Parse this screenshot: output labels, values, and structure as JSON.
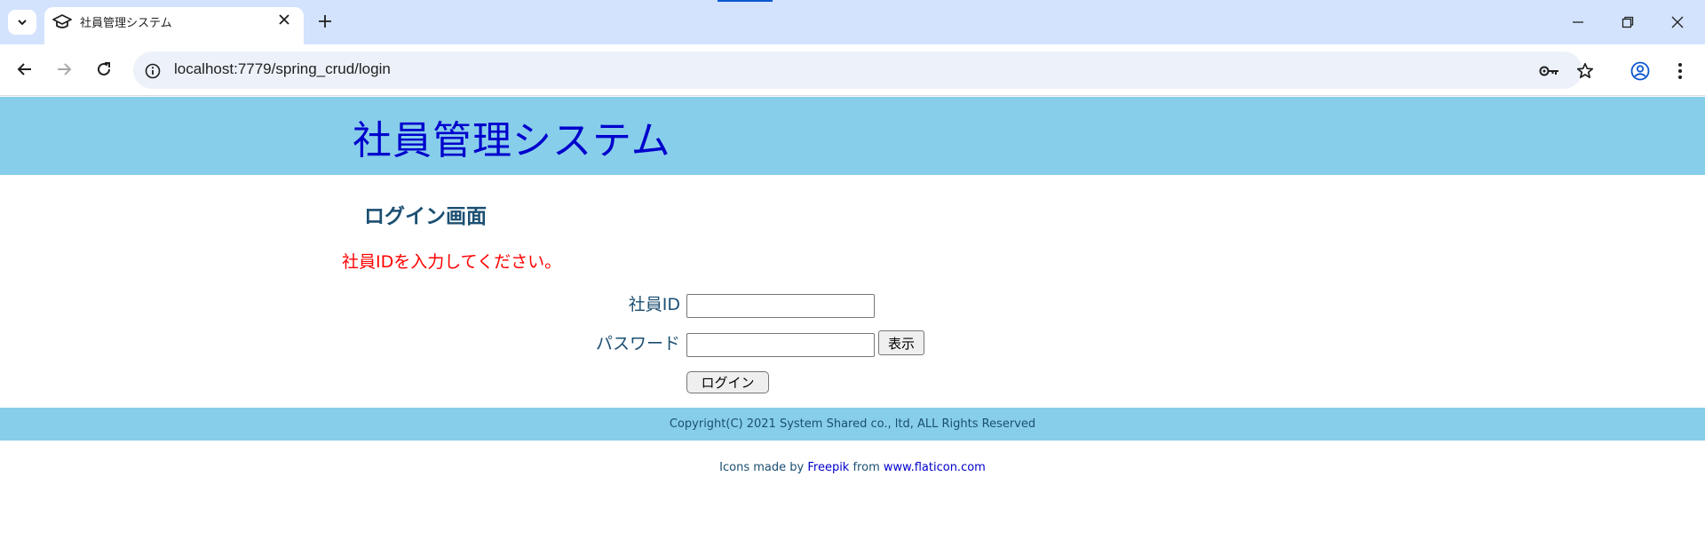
{
  "browser": {
    "tab_title": "社員管理システム",
    "url": "localhost:7779/spring_crud/login",
    "icons": [
      "chevron-down-icon",
      "graduation-cap-icon",
      "close-icon",
      "plus-icon",
      "minimize-icon",
      "restore-icon",
      "window-close-icon",
      "back-icon",
      "forward-icon",
      "reload-icon",
      "info-icon",
      "key-icon",
      "star-icon",
      "profile-icon",
      "menu-icon"
    ]
  },
  "header": {
    "title": "社員管理システム"
  },
  "main": {
    "heading": "ログイン画面",
    "error_message": "社員IDを入力してください。",
    "form": {
      "employee_id_label": "社員ID",
      "employee_id_value": "",
      "password_label": "パスワード",
      "password_value": "",
      "show_button": "表示",
      "login_button": "ログイン"
    }
  },
  "footer": {
    "copyright": "Copyright(C) 2021 System Shared co., ltd, ALL Rights Reserved"
  },
  "credits": {
    "prefix": "Icons made by",
    "author": "Freepik",
    "middle": "from",
    "site": "www.flaticon.com"
  },
  "colors": {
    "header_bg": "#87ceeb",
    "title_color": "#0000cd",
    "error_color": "#ff0000",
    "text_color": "#1b4f72"
  }
}
